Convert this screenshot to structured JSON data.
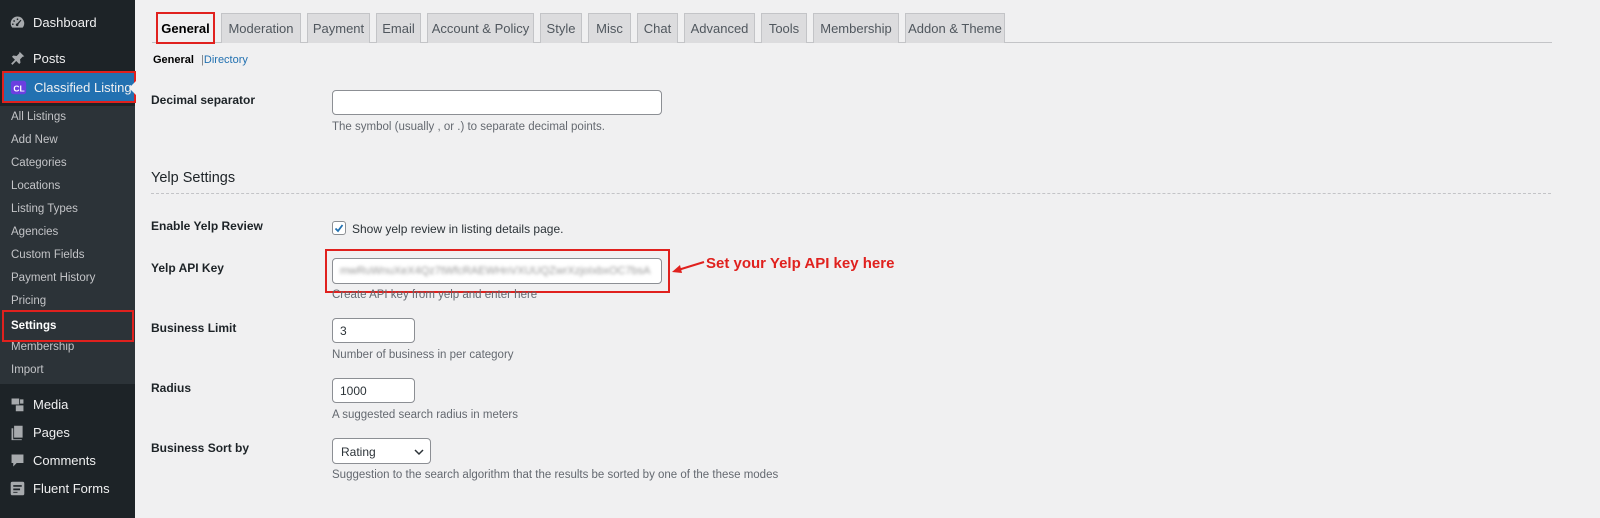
{
  "sidebar": {
    "top_items": [
      {
        "label": "Dashboard",
        "icon": "dashboard-icon"
      },
      {
        "label": "Posts",
        "icon": "pin-icon"
      },
      {
        "label": "Classified Listing",
        "icon": "classified-listing-logo-icon"
      }
    ],
    "submenu": [
      "All Listings",
      "Add New",
      "Categories",
      "Locations",
      "Listing Types",
      "Agencies",
      "Custom Fields",
      "Payment History",
      "Pricing",
      "Settings",
      "Membership",
      "Import"
    ],
    "bottom_items": [
      {
        "label": "Media",
        "icon": "media-icon"
      },
      {
        "label": "Pages",
        "icon": "pages-icon"
      },
      {
        "label": "Comments",
        "icon": "comments-icon"
      },
      {
        "label": "Fluent Forms",
        "icon": "fluent-forms-icon"
      }
    ]
  },
  "tabs": [
    "General",
    "Moderation",
    "Payment",
    "Email",
    "Account & Policy",
    "Style",
    "Misc",
    "Chat",
    "Advanced",
    "Tools",
    "Membership",
    "Addon & Theme"
  ],
  "active_tab": "General",
  "subnav": {
    "current": "General",
    "separator": "|",
    "link": "Directory"
  },
  "fields": {
    "decimal_separator": {
      "label": "Decimal separator",
      "value": "",
      "description": "The symbol (usually , or .) to separate decimal points."
    },
    "yelp_section_title": "Yelp Settings",
    "enable_yelp_review": {
      "label": "Enable Yelp Review",
      "checked": true,
      "checkbox_label": "Show yelp review in listing details page."
    },
    "yelp_api_key": {
      "label": "Yelp API Key",
      "value": "mwRuWnuXeX4Qz7tWfcRAEWHnVXUUQZwrXzjoIxbxOC7bsA",
      "description": "Create API key from yelp and enter here"
    },
    "business_limit": {
      "label": "Business Limit",
      "value": "3",
      "description": "Number of business in per category"
    },
    "radius": {
      "label": "Radius",
      "value": "1000",
      "description": "A suggested search radius in meters"
    },
    "business_sort_by": {
      "label": "Business Sort by",
      "selected": "Rating",
      "description": "Suggestion to the search algorithm that the results be sorted by one of the these modes"
    }
  },
  "annotation": {
    "text": "Set your Yelp API key here",
    "color": "#e0211e"
  },
  "colors": {
    "sidebar_bg": "#1d2327",
    "submenu_bg": "#2c3338",
    "accent": "#2271b1",
    "highlight": "#e0211e"
  }
}
